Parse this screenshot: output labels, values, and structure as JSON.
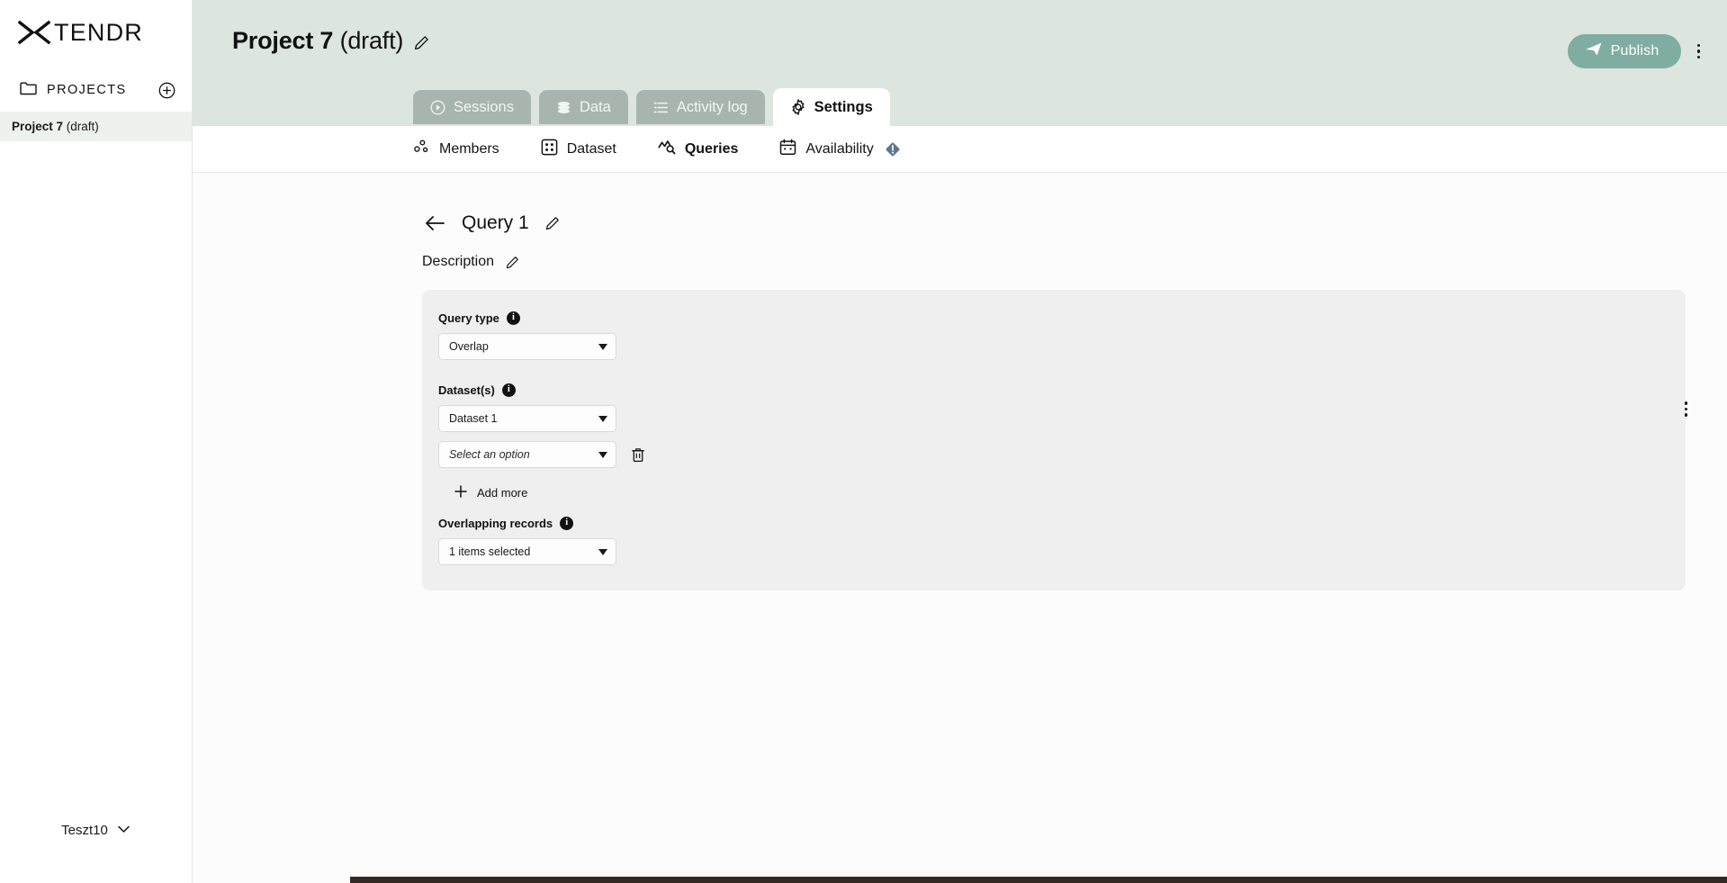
{
  "brand": {
    "name": "TENDR",
    "logo_icon": "x-logo-icon"
  },
  "colors": {
    "topbar_bg": "#dde5df",
    "tab_inactive_bg": "#a7b5ae",
    "publish_bg": "#7fada1",
    "card_bg": "#eeefee",
    "sidebar_active_bg": "#eef2ef",
    "warning_badge": "#5b7792"
  },
  "sidebar": {
    "projects_label": "PROJECTS",
    "folder_icon": "folder-icon",
    "add_icon": "plus-circle-icon",
    "projects": [
      {
        "name": "Project 7",
        "status": "(draft)",
        "active": true
      }
    ],
    "user": {
      "name": "Teszt10",
      "chevron_icon": "chevron-down-icon"
    }
  },
  "header": {
    "project_name": "Project 7",
    "project_status": "(draft)",
    "edit_icon": "pencil-icon",
    "publish_label": "Publish",
    "publish_icon": "send-icon",
    "more_icon": "kebab-menu-icon"
  },
  "tabs": [
    {
      "label": "Sessions",
      "icon": "play-circle-icon",
      "active": false
    },
    {
      "label": "Data",
      "icon": "database-icon",
      "active": false
    },
    {
      "label": "Activity log",
      "icon": "list-icon",
      "active": false
    },
    {
      "label": "Settings",
      "icon": "gear-icon",
      "active": true
    }
  ],
  "subnav": [
    {
      "label": "Members",
      "icon": "people-icon",
      "active": false,
      "badge": null
    },
    {
      "label": "Dataset",
      "icon": "grid-icon",
      "active": false,
      "badge": null
    },
    {
      "label": "Queries",
      "icon": "query-chart-icon",
      "active": true,
      "badge": null
    },
    {
      "label": "Availability",
      "icon": "calendar-icon",
      "active": false,
      "badge": "warning-diamond-icon"
    }
  ],
  "query_page": {
    "back_icon": "arrow-left-icon",
    "title": "Query 1",
    "title_edit_icon": "pencil-icon",
    "more_icon": "kebab-menu-icon",
    "description_label": "Description",
    "description_edit_icon": "pencil-icon",
    "form": {
      "query_type": {
        "label": "Query type",
        "info_icon": "info-icon",
        "value": "Overlap"
      },
      "datasets": {
        "label": "Dataset(s)",
        "info_icon": "info-icon",
        "rows": [
          {
            "value": "Dataset 1",
            "placeholder": false,
            "deletable": false
          },
          {
            "value": "Select an option",
            "placeholder": true,
            "deletable": true,
            "delete_icon": "trash-icon"
          }
        ],
        "add_more_label": "Add more",
        "add_more_icon": "plus-icon"
      },
      "overlapping_records": {
        "label": "Overlapping records",
        "info_icon": "info-icon",
        "value": "1 items selected"
      }
    }
  }
}
